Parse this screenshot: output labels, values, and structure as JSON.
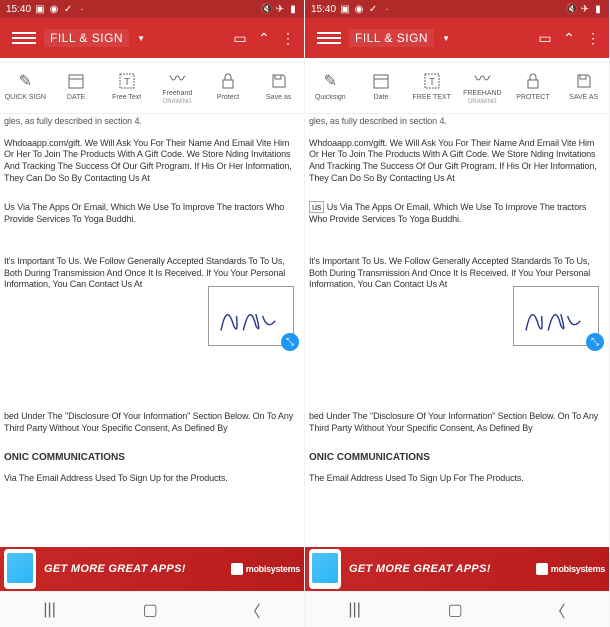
{
  "status": {
    "time": "15:40"
  },
  "appbar": {
    "mode": "FILL & SIGN"
  },
  "toolbar_left": [
    {
      "icon": "✎",
      "label": "QUICK SIGN"
    },
    {
      "icon": "📅",
      "label": "DATE"
    },
    {
      "icon": "T",
      "label": "Free Text"
    },
    {
      "icon": "〰",
      "label": "Freehand",
      "sub": "DRAWING"
    },
    {
      "icon": "🔒",
      "label": "Protect"
    },
    {
      "icon": "💾",
      "label": "Save as"
    }
  ],
  "toolbar_right": [
    {
      "icon": "✎",
      "label": "Quicksign"
    },
    {
      "icon": "📅",
      "label": "Date"
    },
    {
      "icon": "T",
      "label": "FREE TEXT"
    },
    {
      "icon": "〰",
      "label": "FREEHAND",
      "sub": "DRAWING"
    },
    {
      "icon": "🔒",
      "label": "PROTECT"
    },
    {
      "icon": "💾",
      "label": "SAVE AS"
    }
  ],
  "doc": {
    "line0": "gles, as fully described in section 4.",
    "para1": "Whdoaapp.com/gift. We Will Ask You For Their Name And Email Vite Him Or Her To Join The Products With A Gift Code. We Store Nding Invitations And Tracking The Success Of Our Gift Program. If His Or Her Information, They Can Do So By Contacting Us At",
    "para2_prefix_left": "",
    "para2_prefix_right": "us",
    "para2": "Us Via The Apps Or Email, Which We Use To Improve The tractors Who Provide Services To Yoga Buddhi.",
    "para3": "It's Important To Us. We Follow Generally Accepted Standards To To Us, Both During Transmission And Once It Is Received. If You Your Personal Information, You Can Contact Us At",
    "para4": "bed Under The \"Disclosure Of Your Information\" Section Below. On To Any Third Party Without Your Specific Consent, As Defined By",
    "section": "ONIC COMMUNICATIONS",
    "para5_left": "Via The Email Address Used To Sign Up for the Products.",
    "para5_right": "The Email Address Used To Sign Up For The Products."
  },
  "ad": {
    "text": "GET MORE GREAT APPS!",
    "brand": "mobisystems"
  }
}
